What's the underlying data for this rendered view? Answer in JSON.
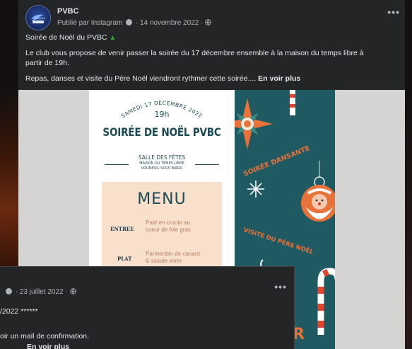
{
  "post": {
    "page_name": "PVBC",
    "meta": "Publié par Instagram",
    "date": "14 novembre 2022",
    "line1": "Soirée de Noël du PVBC",
    "line2": "Le club vous propose de venir passer la soirée du 17 décembre ensemble à la maison du temps libre à",
    "line3": "partir de 19h.",
    "line4": "Repas, danses et visite du Père Noël viendront rythmer cette soirée....",
    "see_more": "En voir plus"
  },
  "poster": {
    "date_arc": "SAMEDI 17 DÉCEMBRE 2022",
    "time": "19h",
    "title": "SOIRÉE DE NOËL PVBC",
    "venue1": "SALLE DES FÊTES",
    "venue2": "MAISON DU TEMPS LIBRE",
    "venue3": "VOUNEUIL SOUS BIARD",
    "menu_title": "MENU",
    "entree_label": "ENTREE",
    "entree_value": "Paté en croute au coeur de foie gras",
    "plat_label": "PLAT",
    "plat_value": "Parmentier de canard & salade verte",
    "right1": "SOIRÉE DANSANTE",
    "right2": "VISITE DU PÈRE NOËL",
    "right3": "R"
  },
  "post2": {
    "date": "23 juillet 2022",
    "line1": "/2022 ******",
    "line2": "oir un mail de confirmation.",
    "see_more": "En voir plus"
  },
  "colors": {
    "card": "#242526",
    "text": "#e4e6eb",
    "muted": "#b0b3b8",
    "poster_teal": "#1f5a63",
    "poster_orange": "#e8723a"
  },
  "icons": [
    "globe-icon",
    "more-icon",
    "tree-emoji",
    "avatar-logo"
  ]
}
